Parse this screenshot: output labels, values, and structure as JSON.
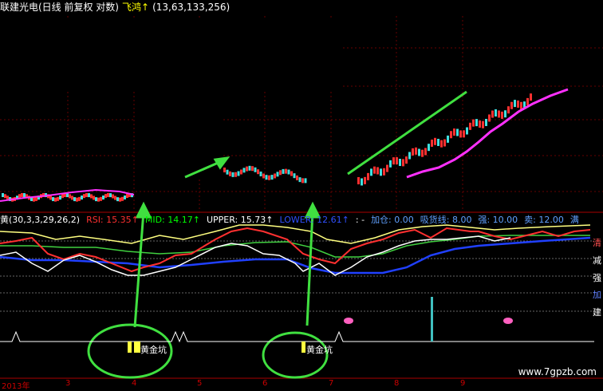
{
  "title_bar": {
    "stock": "联建光电(日线 前复权 对数)",
    "indicator": "飞鸿↑",
    "params": "(13,63,133,256)",
    "stock_color": "#ffffff",
    "indicator_color": "#ffff00",
    "params_color": "#ffffff"
  },
  "indicator_bar": {
    "name": "黄(30,3,3,29,26,2)",
    "rsi": "RSI: 15.35↑",
    "mid": "MID: 14.17↑",
    "upper": "UPPER: 15.73↑",
    "lower": "LOWER: 12.61↑",
    "extra": ": -",
    "jiacang": "加仓: 0.00",
    "xihuo": "吸货线: 8.00",
    "qiang": "强: 10.00",
    "mai": "卖: 12.00",
    "tail": "满",
    "colors": {
      "name": "#ffffff",
      "rsi": "#ff3030",
      "mid": "#00ff00",
      "upper": "#ffffff",
      "lower": "#3050ff",
      "info": "#60a0ff"
    }
  },
  "right_labels": [
    "清",
    "减",
    "强",
    "加",
    "建"
  ],
  "bottom_labels": [
    "黄金坑",
    "黄金坑"
  ],
  "xaxis": {
    "labels": [
      "2013年",
      "3",
      "4",
      "5",
      "6",
      "7",
      "8",
      "9"
    ]
  },
  "watermark": "www.7gpzb.com",
  "chart_data": {
    "type": "line",
    "panels": [
      {
        "panel": "price",
        "series": []
      },
      {
        "panel": "indicator",
        "series": []
      }
    ]
  }
}
